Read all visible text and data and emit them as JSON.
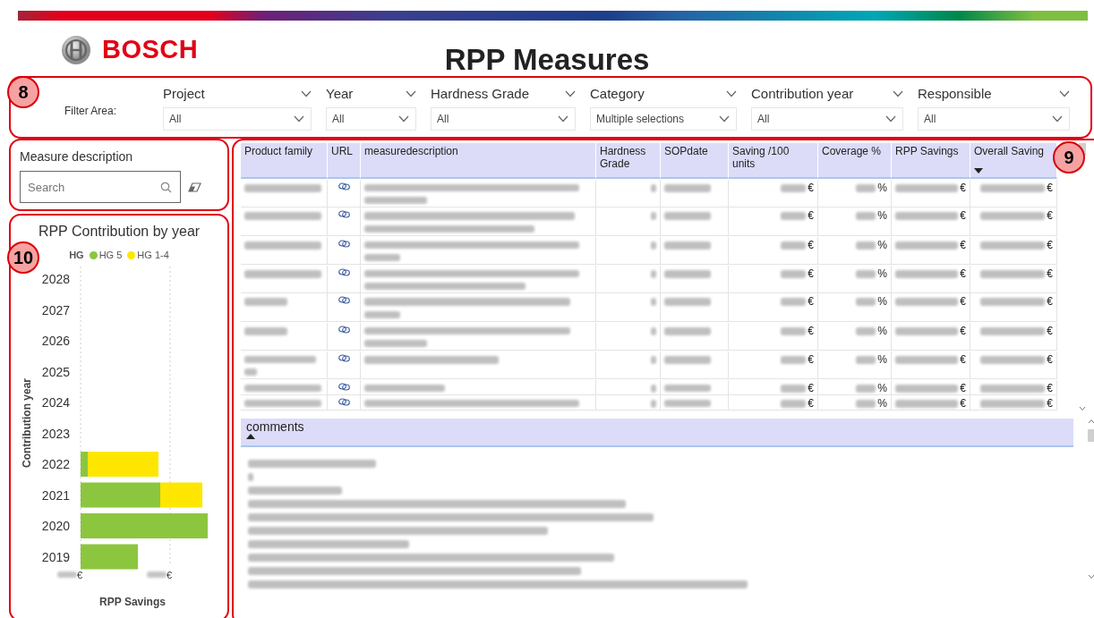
{
  "header": {
    "brand": "BOSCH",
    "title": "RPP Measures"
  },
  "annotations": [
    {
      "label": "8"
    },
    {
      "label": "9"
    },
    {
      "label": "10"
    }
  ],
  "filter_area": {
    "label": "Filter Area:",
    "filters": [
      {
        "name": "Project",
        "value": "All"
      },
      {
        "name": "Year",
        "value": "All"
      },
      {
        "name": "Hardness Grade",
        "value": "All"
      },
      {
        "name": "Category",
        "value": "Multiple selections"
      },
      {
        "name": "Contribution year",
        "value": "All"
      },
      {
        "name": "Responsible",
        "value": "All"
      }
    ]
  },
  "measure_search": {
    "label": "Measure description",
    "placeholder": "Search"
  },
  "chart": {
    "title": "RPP Contribution by year",
    "legend_title": "HG",
    "legend": [
      {
        "name": "HG 5",
        "color": "#8cc63f"
      },
      {
        "name": "HG 1-4",
        "color": "#ffe600"
      }
    ],
    "categories": [
      "2028",
      "2027",
      "2026",
      "2025",
      "2024",
      "2023",
      "2022",
      "2021",
      "2020",
      "2019"
    ],
    "ylabel": "Contribution year",
    "xlabel": "RPP Savings",
    "xtick_units": [
      "€",
      "€"
    ]
  },
  "table": {
    "columns": [
      {
        "label": "Product family",
        "sorted": false
      },
      {
        "label": "URL",
        "sorted": false
      },
      {
        "label": "measuredescription",
        "sorted": false
      },
      {
        "label": "Hardness Grade",
        "sorted": false
      },
      {
        "label": "SOPdate",
        "sorted": false
      },
      {
        "label": "Saving /100 units",
        "sorted": false
      },
      {
        "label": "Coverage %",
        "sorted": false
      },
      {
        "label": "RPP Savings",
        "sorted": false
      },
      {
        "label": "Overall Saving",
        "sorted": true,
        "descending": true
      }
    ],
    "rows": [
      {
        "saving_unit": "€",
        "coverage_unit": "%",
        "rpp_unit": "€",
        "overall_unit": "€"
      },
      {
        "saving_unit": "€",
        "coverage_unit": "%",
        "rpp_unit": "€",
        "overall_unit": "€"
      },
      {
        "saving_unit": "€",
        "coverage_unit": "%",
        "rpp_unit": "€",
        "overall_unit": "€"
      },
      {
        "saving_unit": "€",
        "coverage_unit": "%",
        "rpp_unit": "€",
        "overall_unit": "€"
      },
      {
        "saving_unit": "€",
        "coverage_unit": "%",
        "rpp_unit": "€",
        "overall_unit": "€"
      },
      {
        "saving_unit": "€",
        "coverage_unit": "%",
        "rpp_unit": "€",
        "overall_unit": "€"
      },
      {
        "saving_unit": "€",
        "coverage_unit": "%",
        "rpp_unit": "€",
        "overall_unit": "€"
      },
      {
        "saving_unit": "€",
        "coverage_unit": "%",
        "rpp_unit": "€",
        "overall_unit": "€"
      },
      {
        "saving_unit": "€",
        "coverage_unit": "%",
        "rpp_unit": "€",
        "overall_unit": "€"
      }
    ]
  },
  "comments": {
    "header": "comments",
    "sorted": true,
    "descending": false
  }
}
